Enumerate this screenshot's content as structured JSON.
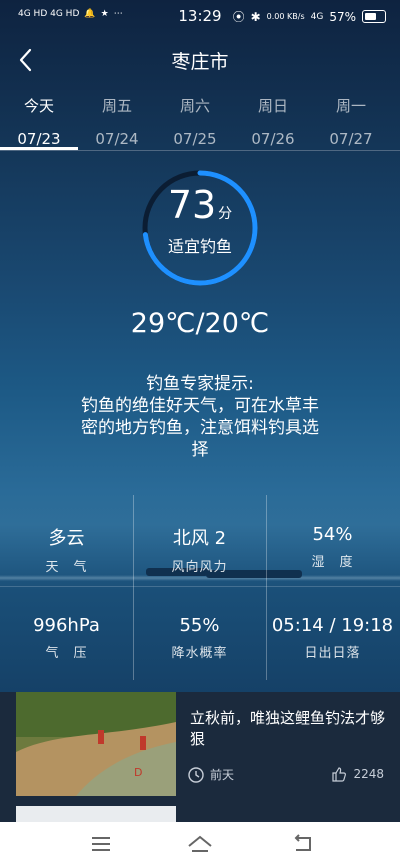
{
  "status_bar": {
    "signal_left": "4G HD 4G HD",
    "time": "13:29",
    "net_speed": "0.00 KB/s",
    "network": "4G",
    "battery": "57%"
  },
  "header": {
    "title": "枣庄市"
  },
  "tabs": [
    {
      "day": "今天",
      "date": "07/23",
      "active": true
    },
    {
      "day": "周五",
      "date": "07/24",
      "active": false
    },
    {
      "day": "周六",
      "date": "07/25",
      "active": false
    },
    {
      "day": "周日",
      "date": "07/26",
      "active": false
    },
    {
      "day": "周一",
      "date": "07/27",
      "active": false
    }
  ],
  "score": {
    "value": "73",
    "unit": "分",
    "label": "适宜钓鱼",
    "ring_fraction": 0.73,
    "ring_color": "#1e90ff"
  },
  "temperature": "29℃/20℃",
  "tips": {
    "heading": "钓鱼专家提示:",
    "body": "钓鱼的绝佳好天气，可在水草丰密的地方钓鱼，注意饵料钓具选择"
  },
  "info": {
    "weather": {
      "value": "多云",
      "key": "天　气"
    },
    "wind": {
      "value": "北风 2",
      "key": "风向风力"
    },
    "humidity": {
      "value": "54%",
      "key": "湿　度"
    },
    "pressure": {
      "value": "996hPa",
      "key": "气　压"
    },
    "rain": {
      "value": "55%",
      "key": "降水概率"
    },
    "sun": {
      "value": "05:14 / 19:18",
      "key": "日出日落"
    }
  },
  "news": {
    "title": "立秋前，唯独这鲤鱼钓法才够狠",
    "time": "前天",
    "likes": "2248"
  }
}
